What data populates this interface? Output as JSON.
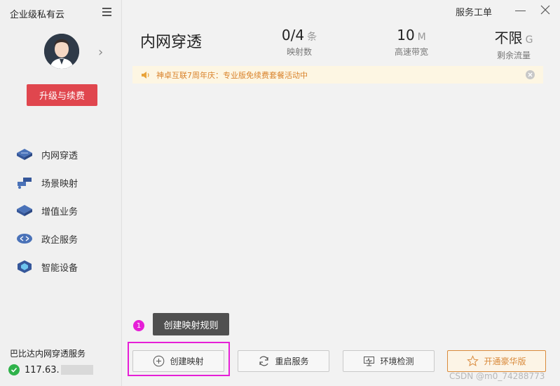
{
  "sidebar": {
    "app_title": "企业级私有云",
    "upgrade_label": "升级与续费",
    "items": [
      {
        "label": "内网穿透",
        "icon": "tunnel-icon"
      },
      {
        "label": "场景映射",
        "icon": "scene-map-icon"
      },
      {
        "label": "增值业务",
        "icon": "value-add-icon"
      },
      {
        "label": "政企服务",
        "icon": "enterprise-icon"
      },
      {
        "label": "智能设备",
        "icon": "smart-device-icon"
      }
    ],
    "service_name": "巴比达内网穿透服务",
    "ip": "117.63."
  },
  "header": {
    "service_ticket": "服务工单",
    "page_title": "内网穿透"
  },
  "stats": [
    {
      "value": "0/4",
      "unit": "条",
      "label": "映射数"
    },
    {
      "value": "10",
      "unit": "M",
      "label": "高速带宽"
    },
    {
      "value": "不限",
      "unit": "G",
      "label": "剩余流量"
    }
  ],
  "banner": {
    "text": "神卓互联7周年庆：专业版免续费套餐活动中"
  },
  "tooltip": {
    "step": "1",
    "text": "创建映射规则"
  },
  "actions": {
    "create": "创建映射",
    "restart": "重启服务",
    "check": "环境检测",
    "deluxe": "开通豪华版"
  },
  "watermark": "CSDN @m0_74288773",
  "colors": {
    "accent_red": "#e0464e",
    "highlight": "#e61fd7",
    "banner_text": "#d9822b",
    "status_green": "#2fb24a"
  }
}
